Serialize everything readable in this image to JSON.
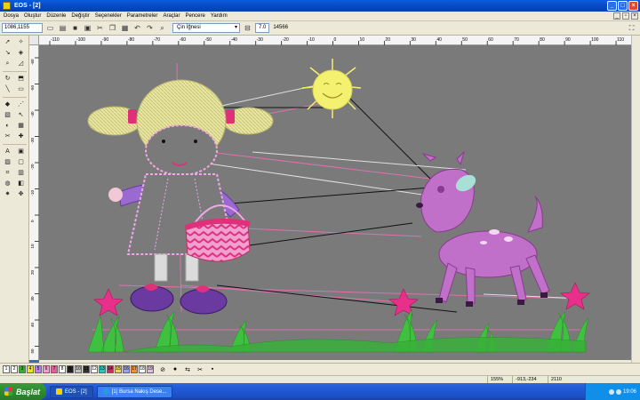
{
  "window": {
    "title": "EOS - [2]"
  },
  "menu": [
    "Dosya",
    "Oluştur",
    "Düzenle",
    "Değiştir",
    "Seçenekler",
    "Parametreler",
    "Araçlar",
    "Pencere",
    "Yardım"
  ],
  "toolbar": {
    "coordinates": "1086,1155",
    "thread_label": "Çin İğnesi",
    "stitch_length": "7.0",
    "stitch_count": "14566"
  },
  "ruler": {
    "top_ticks": [
      "-110",
      "-100",
      "-90",
      "-80",
      "-70",
      "-60",
      "-50",
      "-40",
      "-30",
      "-20",
      "-10",
      "0",
      "10",
      "20",
      "30",
      "40",
      "50",
      "60",
      "70",
      "80",
      "90",
      "100",
      "110"
    ],
    "left_ticks": [
      "-60",
      "-50",
      "-40",
      "-30",
      "-20",
      "-10",
      "0",
      "10",
      "20",
      "30",
      "40",
      "50"
    ]
  },
  "palette": {
    "swatches": [
      {
        "label": "1",
        "color": "#ffffff"
      },
      {
        "label": "2",
        "color": "#ffffff"
      },
      {
        "label": "3",
        "color": "#30b030"
      },
      {
        "label": "4",
        "color": "#f0e020"
      },
      {
        "label": "5",
        "color": "#c080e0"
      },
      {
        "label": "6",
        "color": "#f0a0d0"
      },
      {
        "label": "7",
        "color": "#e060a0"
      },
      {
        "label": "8",
        "color": "#ffffff"
      },
      {
        "label": "9",
        "color": "#202020"
      },
      {
        "label": "10",
        "color": "#c0c0c0"
      },
      {
        "label": "11",
        "color": "#303030"
      },
      {
        "label": "12",
        "color": "#ffffff"
      },
      {
        "label": "13",
        "color": "#30c0c0"
      },
      {
        "label": "14",
        "color": "#c03060"
      },
      {
        "label": "15",
        "color": "#f0d060"
      },
      {
        "label": "16",
        "color": "#a0a0f0"
      },
      {
        "label": "17",
        "color": "#f09030"
      },
      {
        "label": "18",
        "color": "#ffffff"
      },
      {
        "label": "19",
        "color": "#e0c0e0"
      }
    ]
  },
  "status": {
    "zoom": "155%",
    "cursor": "-913,-234",
    "stitch": "2110"
  },
  "taskbar": {
    "start_label": "Başlat",
    "tasks": [
      "EOS - [2]",
      "[1] Bursa Nakış Dese..."
    ],
    "clock": "19:06"
  },
  "design": {
    "thread_colors": {
      "hair": "#e8e6a0",
      "hair_shadow": "#b8b46a",
      "bow": "#e0307a",
      "skin": "#f2c8d8",
      "sweater": "#9a6ad0",
      "dress": "#f2a8e8",
      "basket": "#e0609a",
      "shoe": "#6a3aa0",
      "sun": "#f4f070",
      "deer": "#c070c8",
      "deer_dark": "#8a3a90",
      "flower": "#e8308a",
      "grass": "#40c040",
      "jump_pink": "#e070b0",
      "jump_black": "#111111",
      "jump_white": "#e0e0e0"
    }
  }
}
